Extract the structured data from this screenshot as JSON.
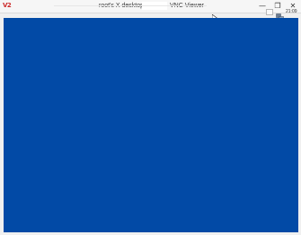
{
  "window": {
    "logo_text": "V2",
    "title_left": "root's X desktop",
    "title_right": "VNC Viewer",
    "minimize_label": "—",
    "restore_label": "❐",
    "close_label": "✕"
  },
  "tray": {
    "clock": "21:09",
    "network_icon": "network-icon",
    "box_icon": "tray-box-icon"
  },
  "colors": {
    "desktop_bg": "#024aa6",
    "titlebar_bg": "#f6f6f6",
    "logo": "#cc2a2a"
  }
}
